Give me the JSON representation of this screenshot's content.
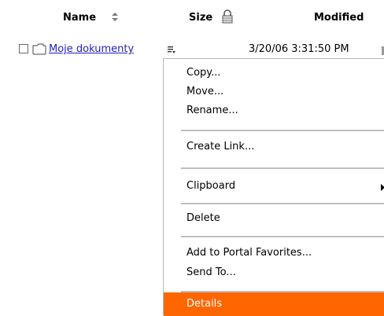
{
  "columns": {
    "name": "Name",
    "size": "Size",
    "modified": "Modified"
  },
  "file": {
    "name": "Moje dokumenty",
    "modified": "3/20/06 3:31:50 PM"
  },
  "context_menu": {
    "items": [
      {
        "label": "Copy..."
      },
      {
        "label": "Move..."
      },
      {
        "label": "Rename..."
      },
      {
        "label": "Create Link..."
      },
      {
        "label": "Clipboard"
      },
      {
        "label": "Delete"
      },
      {
        "label": "Add to Portal Favorites..."
      },
      {
        "label": "Send To..."
      },
      {
        "label": "Details"
      }
    ],
    "selected_index": 8
  },
  "colors": {
    "link": "#1f1fbf",
    "highlight": "#ff6600",
    "separator": "#c0c0c0"
  },
  "icons": [
    "sort-updown-icon",
    "lock-icon",
    "checkbox",
    "folder-icon",
    "item-menu-icon",
    "submenu-arrow-icon"
  ]
}
